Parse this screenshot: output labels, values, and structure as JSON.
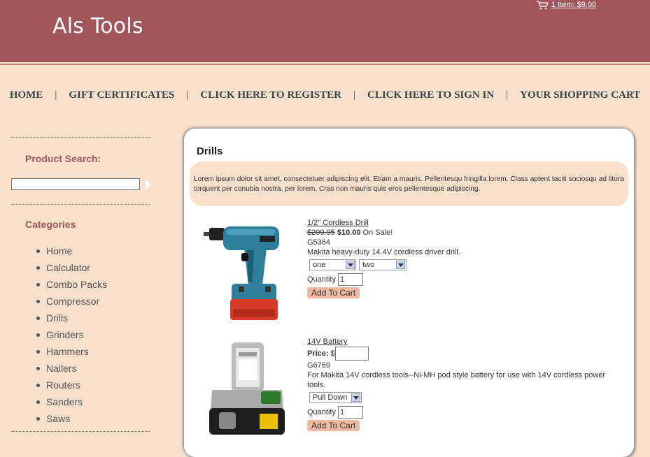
{
  "header": {
    "logo": "Als Tools",
    "cart_summary": "1 Item: $9.00"
  },
  "nav": [
    "HOME",
    "GIFT CERTIFICATES",
    "CLICK HERE TO REGISTER",
    "CLICK HERE TO SIGN IN",
    "YOUR SHOPPING CART"
  ],
  "nav_separator": "|",
  "sidebar": {
    "search_title": "Product Search:",
    "search_value": "",
    "categories_title": "Categories",
    "categories": [
      "Home",
      "Calculator",
      "Combo Packs",
      "Compressor",
      "Drills",
      "Grinders",
      "Hammers",
      "Nailers",
      "Routers",
      "Sanders",
      "Saws"
    ]
  },
  "main": {
    "title": "Drills",
    "description": "Lorem ipsum dolor sit amet, consectetuer adipiscing elit. Etiam a mauris. Pellentesqu fringilla lorem. Class aptent taciti sociosqu ad litora torquent per conubia nostra, per lorem. Cras non mauris quis eros pellentesque adipiscing."
  },
  "products": [
    {
      "name": "1/2\" Cordless Drill",
      "old_price": "$209.95",
      "new_price": "$10.00",
      "sale_text": "On Sale!",
      "sku": "G5364",
      "desc": "Makita heavy-duty 14.4V cordless driver drill.",
      "option1": "one",
      "option2": "two",
      "qty_label": "Quantity",
      "qty_value": "1",
      "add_label": "Add To Cart"
    },
    {
      "name": "14V Battery",
      "price_label": "Price:",
      "price_currency": "$",
      "price_value": "",
      "sku": "G6769",
      "desc": "For Makita 14V cordless tools--Ni-MH pod style battery for use with 14V cordless power tools.",
      "option1": "Pull Down",
      "qty_label": "Quantity",
      "qty_value": "1",
      "add_label": "Add To Cart"
    }
  ],
  "colors": {
    "header_bg": "#a0565a",
    "page_bg": "#f9e0cc",
    "accent": "#a0565a",
    "button_bg": "#f0b8a0"
  }
}
